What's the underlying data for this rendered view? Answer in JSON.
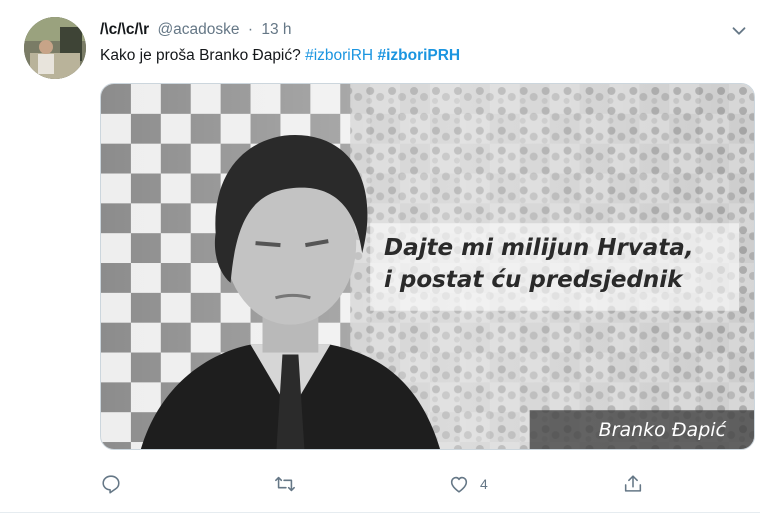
{
  "tweet": {
    "display_name": "/\\c/\\c/\\r",
    "handle": "@acadoske",
    "separator": "·",
    "time": "13 h",
    "text": "Kako je proša Branko Đapić?",
    "hashtags": [
      "#izboriRH",
      "#izboriPRH"
    ],
    "media": {
      "quote_line_1": "Dajte mi milijun Hrvata,",
      "quote_line_2": "i postat ću predsjednik",
      "caption_name": "Branko Đapić"
    },
    "actions": {
      "reply_count": "",
      "retweet_count": "",
      "like_count": "4",
      "share_count": ""
    }
  },
  "icons": {
    "avatar": "avatar",
    "caret": "chevron-down-icon",
    "reply": "reply-icon",
    "retweet": "retweet-icon",
    "like": "heart-icon",
    "share": "share-icon"
  },
  "colors": {
    "text": "#14171a",
    "secondary": "#657786",
    "hashtag": "#1b95e0"
  }
}
